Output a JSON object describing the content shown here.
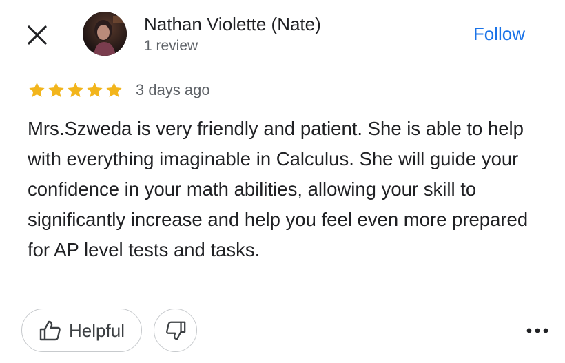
{
  "header": {
    "close_icon": "close-icon",
    "author_name": "Nathan Violette (Nate)",
    "review_count": "1 review",
    "follow_label": "Follow"
  },
  "review": {
    "rating": 5,
    "rating_max": 5,
    "date": "3 days ago",
    "text": "Mrs.Szweda is very friendly and patient. She is able to help with everything imaginable in Calculus. She will guide your confidence in your math abilities, allowing your skill to significantly increase and help you feel even more prepared for AP level tests and tasks."
  },
  "actions": {
    "helpful_label": "Helpful",
    "helpful_icon": "thumbs-up-icon",
    "dislike_icon": "thumbs-down-icon",
    "more_icon": "more-options-icon"
  },
  "colors": {
    "accent": "#1a73e8",
    "star": "#f2b51c",
    "text_primary": "#202124",
    "text_secondary": "#5f6368",
    "border": "#c7cacd"
  }
}
